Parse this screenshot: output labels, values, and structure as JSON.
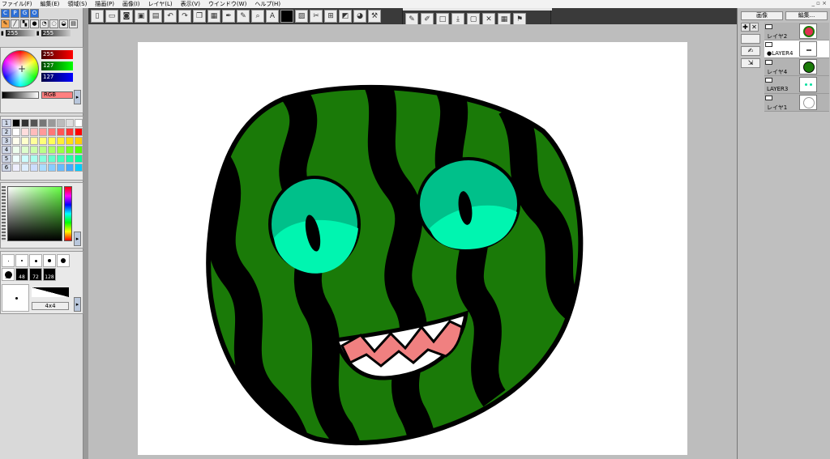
{
  "menu": {
    "items": [
      "ファイル(F)",
      "編集(E)",
      "領域(S)",
      "描画(P)",
      "画像(I)",
      "レイヤ(L)",
      "表示(V)",
      "ウインドウ(W)",
      "ヘルプ(H)"
    ],
    "window_controls": "_ ▫ ×"
  },
  "left": {
    "brush_size_a": "255",
    "brush_size_b": "255",
    "color_values": {
      "r": "255",
      "g": "127",
      "b": "127"
    },
    "mode_label": "RGB",
    "palette_rows": [
      "1",
      "2",
      "3",
      "4",
      "5",
      "6"
    ],
    "palette_colors": [
      [
        "#000000",
        "#333333",
        "#555555",
        "#777777",
        "#999999",
        "#bbbbbb",
        "#dddddd",
        "#ffffff"
      ],
      [
        "#ffffff",
        "#ffdddd",
        "#ffbbbb",
        "#ff9999",
        "#ff7777",
        "#ff5555",
        "#ff3333",
        "#ff0000"
      ],
      [
        "#ffffee",
        "#ffffcc",
        "#ffff99",
        "#ffff77",
        "#ffff55",
        "#ffee33",
        "#ffdd11",
        "#ffcc00"
      ],
      [
        "#eeffee",
        "#ddffcc",
        "#ccffaa",
        "#bbff88",
        "#aaff66",
        "#99ff44",
        "#77ff22",
        "#55ff00"
      ],
      [
        "#eeffff",
        "#ccffff",
        "#aaffee",
        "#88ffdd",
        "#66ffcc",
        "#44ffbb",
        "#22ffaa",
        "#00ff99"
      ],
      [
        "#eeeeff",
        "#ddeeff",
        "#ccddff",
        "#aaddff",
        "#88ccff",
        "#66bbff",
        "#44aaff",
        "#00ccff"
      ]
    ],
    "brush_sizes": [
      "",
      "",
      "",
      "",
      "",
      "32",
      "48",
      "72",
      "128"
    ],
    "brush_preset": "4x4"
  },
  "layers": {
    "tab_image": "画像",
    "tab_edit": "編集...",
    "items": [
      {
        "name": "レイヤ2",
        "active": false
      },
      {
        "name": "●LAYER4",
        "active": true
      },
      {
        "name": "レイヤ4",
        "active": false
      },
      {
        "name": "LAYER3",
        "active": false
      },
      {
        "name": "レイヤ1",
        "active": false
      }
    ]
  },
  "colors": {
    "melon_dark": "#1a7a08",
    "stripe": "#000000",
    "eye_outer": "#00c08a",
    "eye_inner": "#00f5b0",
    "gum": "#f08080"
  }
}
